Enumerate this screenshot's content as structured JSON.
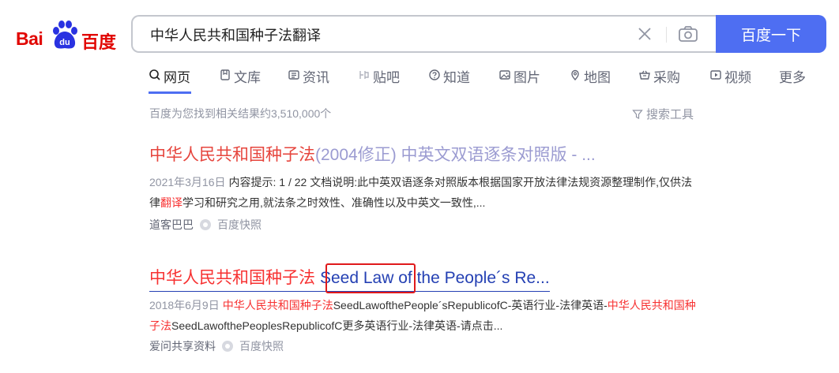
{
  "logo": {
    "bai": "Bai",
    "du": "du",
    "text": "百度"
  },
  "search": {
    "query": "中华人民共和国种子法翻译",
    "button_label": "百度一下"
  },
  "tabs": [
    {
      "label": "网页",
      "icon": "search-icon"
    },
    {
      "label": "文库",
      "icon": "document-icon"
    },
    {
      "label": "资讯",
      "icon": "news-icon"
    },
    {
      "label": "贴吧",
      "icon": "tieba-icon"
    },
    {
      "label": "知道",
      "icon": "question-icon"
    },
    {
      "label": "图片",
      "icon": "image-icon"
    },
    {
      "label": "地图",
      "icon": "map-pin-icon"
    },
    {
      "label": "采购",
      "icon": "shopping-basket-icon"
    },
    {
      "label": "视频",
      "icon": "video-icon"
    },
    {
      "label": "更多",
      "icon": ""
    }
  ],
  "result_count": "百度为您找到相关结果约3,510,000个",
  "search_tools": "搜索工具",
  "results": [
    {
      "title_hl": "中华人民共和国种子法",
      "title_rest": "(2004修正) 中英文双语逐条对照版 - ...",
      "date": "2021年3月16日",
      "abs_1": "内容提示: 1 / 22 文档说明:此中英双语逐条对照版本根据国家开放法律法规资源整理制作,仅供法律",
      "abs_hl": "翻译",
      "abs_2": "学习和研究之用,就法条之时效性、准确性以及中英文一致性,...",
      "source": "道客巴巴",
      "snapshot": "百度快照"
    },
    {
      "title_hl": "中华人民共和国种子法",
      "title_boxed": "Seed Law",
      "title_rest": " of the People´s Re...",
      "date": "2018年6月9日",
      "abs_hl_1": "中华人民共和国种子法",
      "abs_1": "SeedLawofthePeople´sRepublicofC-英语行业-法律英语-",
      "abs_hl_2": "中华人民共和国种子法",
      "abs_2": "SeedLawofthePeoplesRepublicofC更多英语行业-法律英语-请点击...",
      "source": "爱问共享资料",
      "snapshot": "百度快照"
    }
  ],
  "colors": {
    "accent": "#4e6ef2",
    "highlight": "#f73131",
    "link": "#2440b3",
    "annotation_box": "#e0191b"
  }
}
